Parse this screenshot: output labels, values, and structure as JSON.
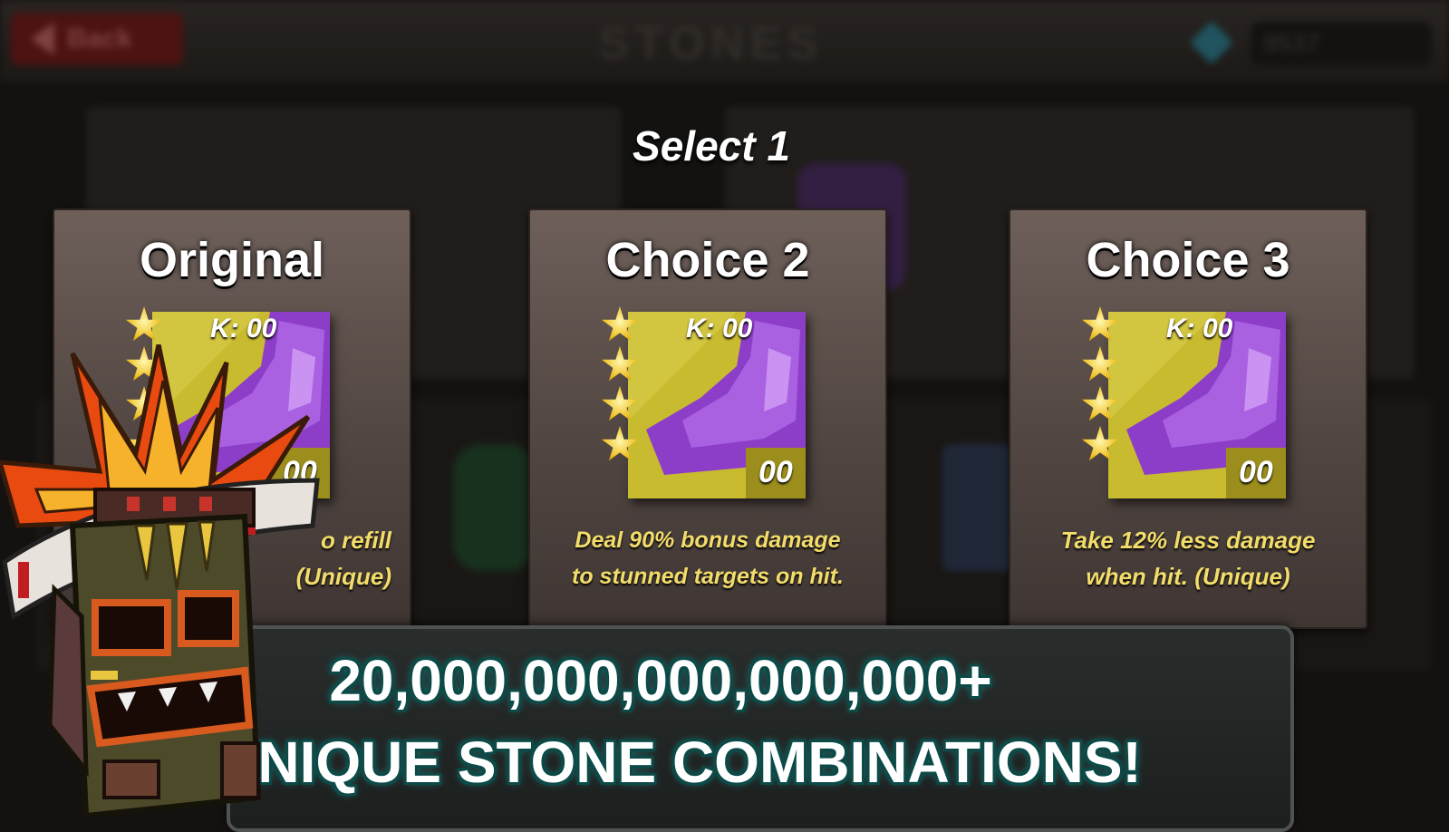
{
  "background": {
    "back_label": "Back",
    "screen_title": "STONES",
    "currency_value": "9537"
  },
  "dialog": {
    "title": "Select 1",
    "cards": [
      {
        "title": "Original",
        "kill_label": "K: 00",
        "slot_label": "00",
        "stars": 4,
        "description_line_1": "o refill",
        "description_line_2": "(Unique)"
      },
      {
        "title": "Choice 2",
        "kill_label": "K: 00",
        "slot_label": "00",
        "stars": 4,
        "description_line_1": "Deal 90% bonus damage",
        "description_line_2": "to stunned targets on hit."
      },
      {
        "title": "Choice 3",
        "kill_label": "K: 00",
        "slot_label": "00",
        "stars": 4,
        "description_line_1": "Take 12% less damage",
        "description_line_2": "when hit. (Unique)"
      }
    ]
  },
  "banner": {
    "line_1": "20,000,000,000,000,000+",
    "line_2": "UNIQUE STONE COMBINATIONS!"
  },
  "colors": {
    "card_bg": "#5a4d48",
    "description_text": "#f2dc6a",
    "stone_gold": "#c9b72a",
    "stone_purple": "#9b4fd6",
    "banner_glow": "#1a8f8a"
  }
}
